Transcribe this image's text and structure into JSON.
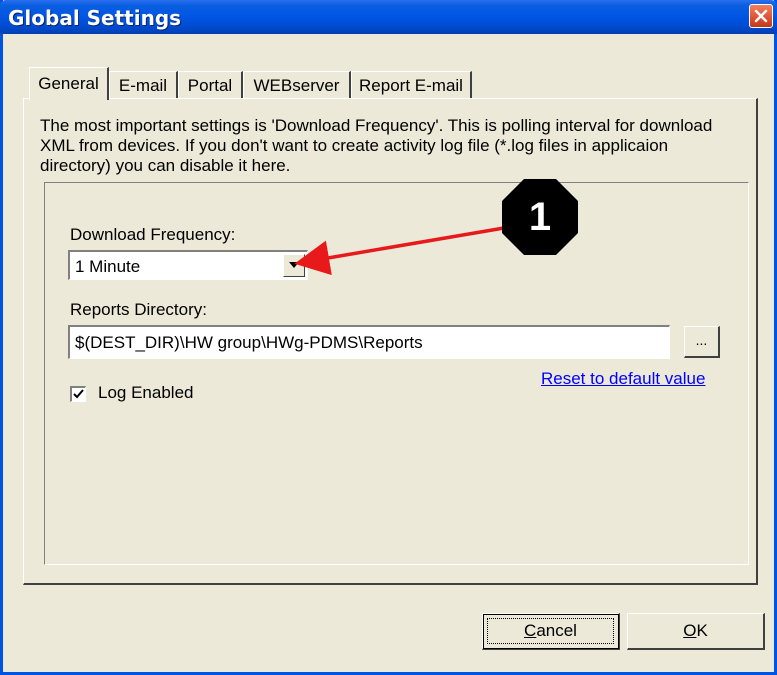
{
  "window": {
    "title": "Global Settings"
  },
  "tabs": [
    {
      "label": "General"
    },
    {
      "label": "E-mail"
    },
    {
      "label": "Portal"
    },
    {
      "label": "WEBserver"
    },
    {
      "label": "Report E-mail"
    }
  ],
  "general": {
    "description": "The most important settings is 'Download Frequency'. This is polling interval for download XML from devices. If you don't want to create activity log file (*.log files in applicaion directory) you can disable it here.",
    "download_frequency_label": "Download Frequency:",
    "download_frequency_value": "1 Minute",
    "reports_directory_label": "Reports Directory:",
    "reports_directory_value": "$(DEST_DIR)\\HW group\\HWg-PDMS\\Reports",
    "browse_label": "...",
    "reset_link": "Reset to default value",
    "log_enabled_label": "Log Enabled",
    "log_enabled_checked": true
  },
  "buttons": {
    "cancel_prefix": "",
    "cancel_accel": "C",
    "cancel_rest": "ancel",
    "ok_accel": "O",
    "ok_rest": "K"
  },
  "annotation": {
    "callout_number": "1",
    "arrow_color": "#e8191b"
  },
  "colors": {
    "titlebar": "#0055e5",
    "dialog_bg": "#ece9d8",
    "link": "#0000ff"
  },
  "icons": {
    "close": "close-icon",
    "dropdown": "chevron-down-icon",
    "check": "check-icon"
  }
}
